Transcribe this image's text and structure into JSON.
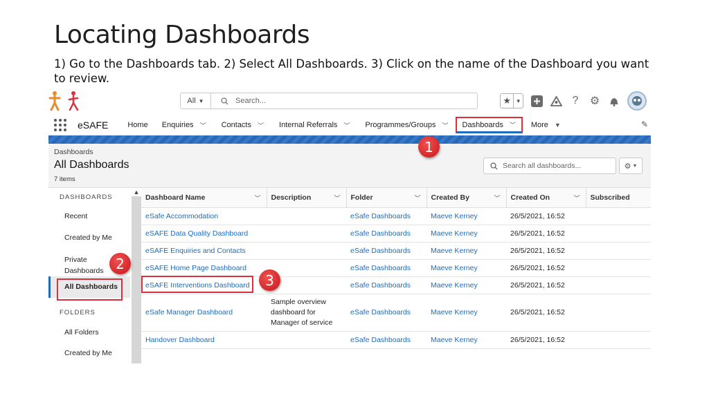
{
  "slide": {
    "title": "Locating Dashboards",
    "subtitle": "1) Go to the Dashboards tab. 2) Select All Dashboards. 3) Click on the name of the Dashboard you want to review."
  },
  "topbar": {
    "scope": "All",
    "search_placeholder": "Search..."
  },
  "nav": {
    "app_name": "eSAFE",
    "items": [
      "Home",
      "Enquiries",
      "Contacts",
      "Internal Referrals",
      "Programmes/Groups",
      "Dashboards",
      "More"
    ]
  },
  "list": {
    "breadcrumb": "Dashboards",
    "title": "All Dashboards",
    "count": "7 items",
    "search_placeholder": "Search all dashboards..."
  },
  "sidebar": {
    "section1": "DASHBOARDS",
    "items1": [
      "Recent",
      "Created by Me",
      "Private Dashboards",
      "All Dashboards"
    ],
    "section2": "FOLDERS",
    "items2": [
      "All Folders",
      "Created by Me"
    ]
  },
  "table": {
    "headers": [
      "Dashboard Name",
      "Description",
      "Folder",
      "Created By",
      "Created On",
      "Subscribed"
    ],
    "rows": [
      {
        "name": "eSafe Accommodation",
        "desc": "",
        "folder": "eSafe Dashboards",
        "by": "Maeve Kerney",
        "on": "26/5/2021, 16:52"
      },
      {
        "name": "eSAFE Data Quality Dashboard",
        "desc": "",
        "folder": "eSafe Dashboards",
        "by": "Maeve Kerney",
        "on": "26/5/2021, 16:52"
      },
      {
        "name": "eSAFE Enquiries and Contacts",
        "desc": "",
        "folder": "eSafe Dashboards",
        "by": "Maeve Kerney",
        "on": "26/5/2021, 16:52"
      },
      {
        "name": "eSAFE Home Page Dashboard",
        "desc": "",
        "folder": "eSafe Dashboards",
        "by": "Maeve Kerney",
        "on": "26/5/2021, 16:52"
      },
      {
        "name": "eSAFE Interventions Dashboard",
        "desc": "",
        "folder": "eSafe Dashboards",
        "by": "Maeve Kerney",
        "on": "26/5/2021, 16:52"
      },
      {
        "name": "eSafe Manager Dashboard",
        "desc": "Sample overview dashboard for Manager of service",
        "folder": "eSafe Dashboards",
        "by": "Maeve Kerney",
        "on": "26/5/2021, 16:52"
      },
      {
        "name": "Handover Dashboard",
        "desc": "",
        "folder": "eSafe Dashboards",
        "by": "Maeve Kerney",
        "on": "26/5/2021, 16:52"
      }
    ]
  },
  "steps": [
    "1",
    "2",
    "3"
  ],
  "colors": {
    "accent": "#1b6cc1",
    "highlight": "#d9303d"
  },
  "icons": [
    "logo-figures",
    "search-icon",
    "star-icon",
    "add-icon",
    "trailhead-icon",
    "help-icon",
    "gear-icon",
    "bell-icon",
    "avatar",
    "waffle-icon",
    "pencil-icon"
  ]
}
